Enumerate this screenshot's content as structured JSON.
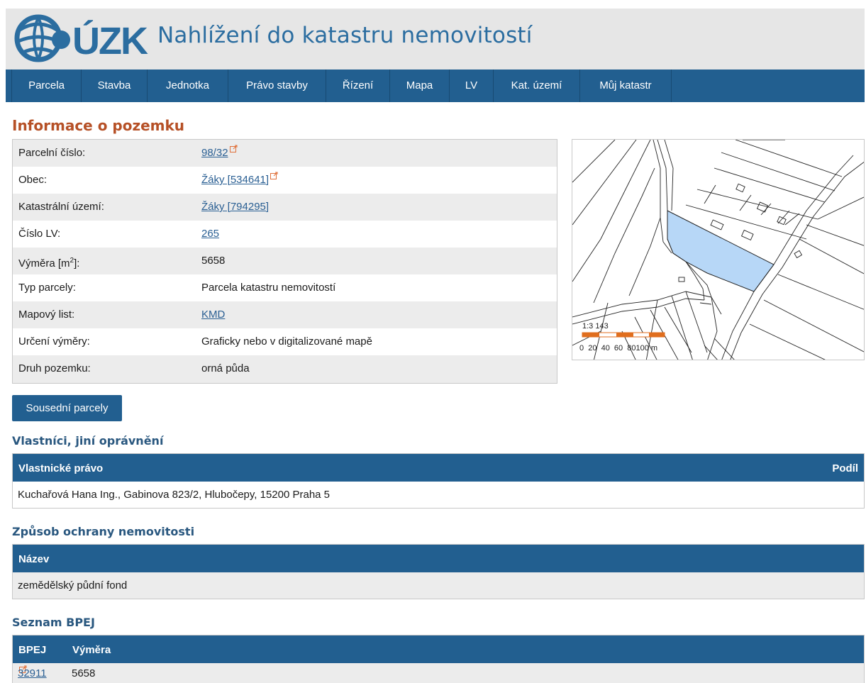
{
  "header": {
    "logo_text": "ČÚZK",
    "title": "Nahlížení do katastru nemovitostí"
  },
  "nav": [
    {
      "label": "Parcela"
    },
    {
      "label": "Stavba"
    },
    {
      "label": "Jednotka"
    },
    {
      "label": "Právo stavby"
    },
    {
      "label": "Řízení"
    },
    {
      "label": "Mapa"
    },
    {
      "label": "LV"
    },
    {
      "label": "Kat. území"
    },
    {
      "label": "Můj katastr"
    }
  ],
  "main": {
    "title": "Informace o pozemku",
    "rows": [
      {
        "label": "Parcelní číslo:",
        "value": "98/32"
      },
      {
        "label": "Obec:",
        "value": "Žáky [534641]"
      },
      {
        "label": "Katastrální území:",
        "value": "Žáky [794295]"
      },
      {
        "label": "Číslo LV:",
        "value": "265"
      },
      {
        "label": "Výměra [m",
        "label_sup": "2",
        "label_tail": "]:",
        "value": "5658"
      },
      {
        "label": "Typ parcely:",
        "value": "Parcela katastru nemovitostí"
      },
      {
        "label": "Mapový list:",
        "value": "KMD"
      },
      {
        "label": "Určení výměry:",
        "value": "Graficky nebo v digitalizované mapě"
      },
      {
        "label": "Druh pozemku:",
        "value": "orná půda"
      }
    ],
    "neighbors_button": "Sousední parcely"
  },
  "map": {
    "scale_label": "1:3 143",
    "scale_ticks": "0  20  40  60  80100 m",
    "parcel_color": "#b7d7f7",
    "scale_color": "#e06e1e"
  },
  "owners": {
    "title": "Vlastníci, jiní oprávnění",
    "header_left": "Vlastnické právo",
    "header_right": "Podíl",
    "row": "Kuchařová Hana Ing., Gabinova 823/2, Hlubočepy, 15200 Praha 5"
  },
  "protection": {
    "title": "Způsob ochrany nemovitosti",
    "header": "Název",
    "row": "zemědělský půdní fond"
  },
  "bpej": {
    "title": "Seznam BPEJ",
    "header_code": "BPEJ",
    "header_area": "Výměra",
    "code": "32911",
    "area": "5658"
  }
}
